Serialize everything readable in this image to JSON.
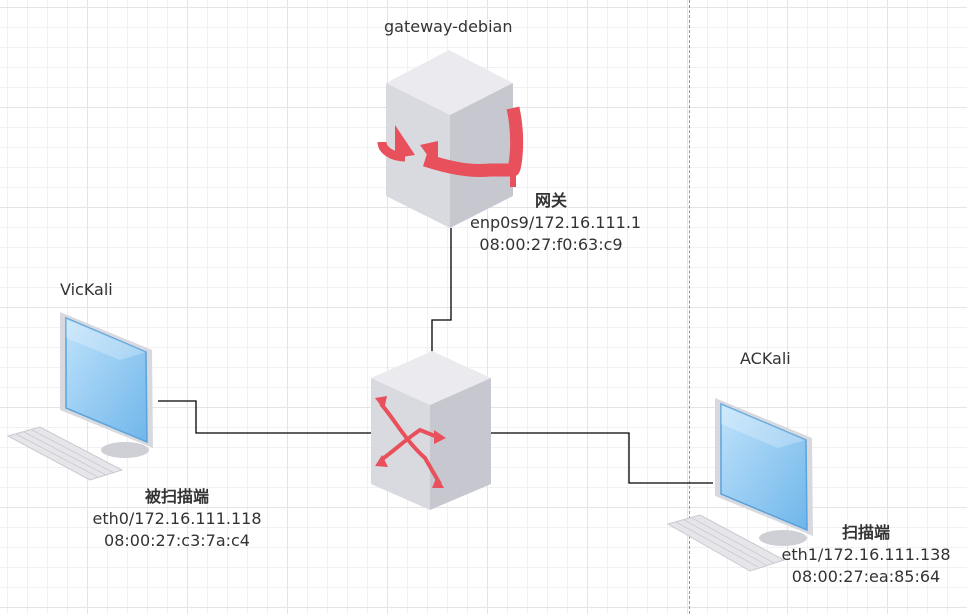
{
  "nodes": {
    "gateway": {
      "name": "gateway-debian",
      "role": "网关",
      "interface": "enp0s9/172.16.111.1",
      "mac": "08:00:27:f0:63:c9"
    },
    "victim": {
      "name": "VicKali",
      "role": "被扫描端",
      "interface": "eth0/172.16.111.118",
      "mac": "08:00:27:c3:7a:c4"
    },
    "attacker": {
      "name": "ACKali",
      "role": "扫描端",
      "interface": "eth1/172.16.111.138",
      "mac": "08:00:27:ea:85:64"
    }
  },
  "colors": {
    "device_face": "#dcdde3",
    "device_side": "#c9cad1",
    "device_top": "#ebebef",
    "accent_red": "#e8505b",
    "screen_blue": "#8ec9f2",
    "link": "#000000",
    "guide": "#8c8ce6"
  },
  "icons": {
    "gateway": "router-server-icon",
    "switch": "switch-icon",
    "victim": "desktop-computer-icon",
    "attacker": "desktop-computer-icon"
  }
}
